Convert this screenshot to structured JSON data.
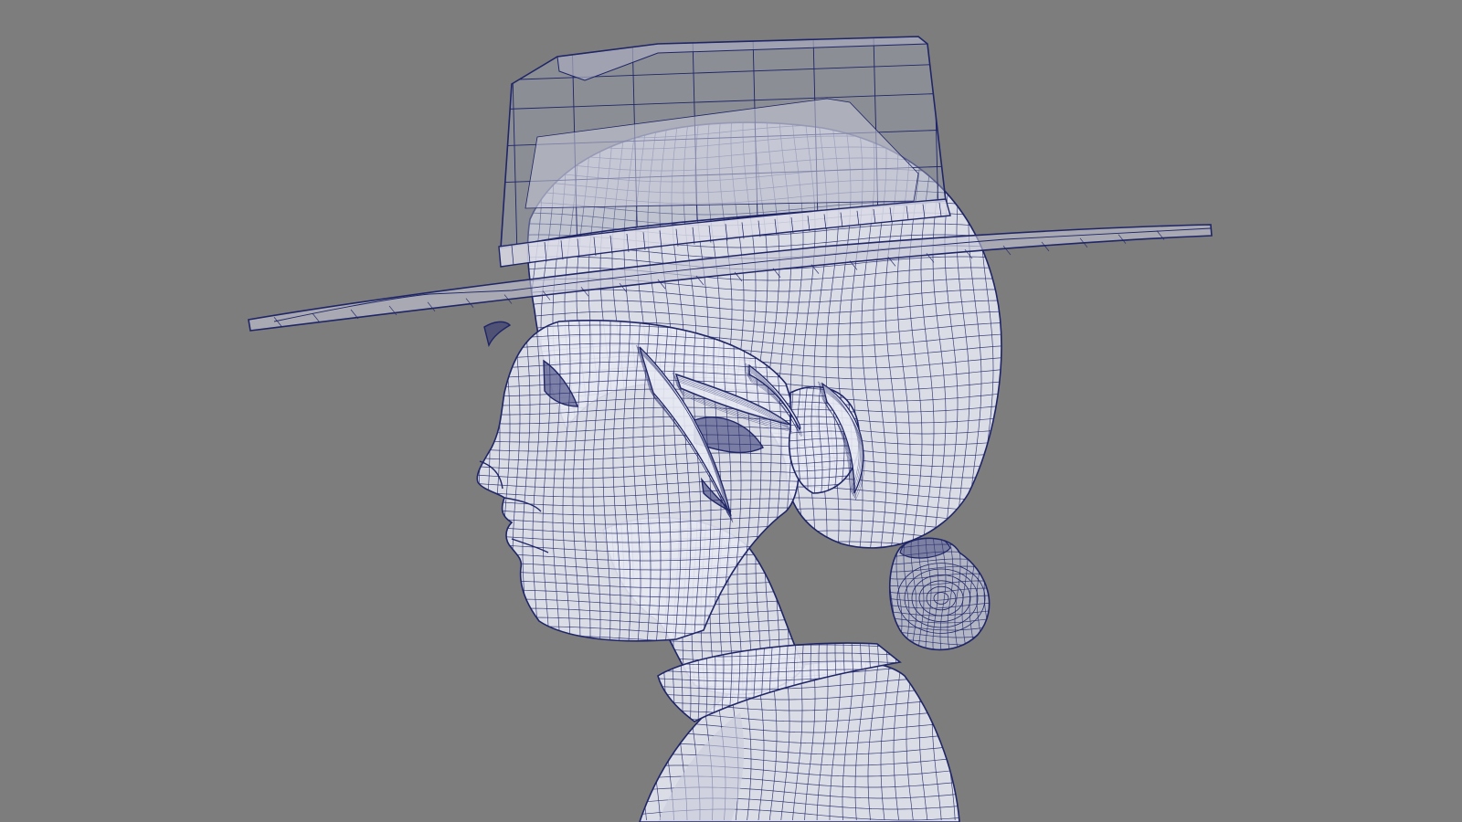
{
  "viewport": {
    "background_color": "#7d7d7d",
    "wire_color": "#1f2566",
    "mesh_fill_color": "#e6e8f2",
    "mesh_shade_color": "#c8cbdc",
    "display_mode": "wireframe-on-shaded"
  },
  "scene": {
    "model_view": "side-profile",
    "objects": [
      "hat",
      "hat-brim",
      "hat-band",
      "hair",
      "hair-bun",
      "face",
      "ear",
      "neck",
      "collar",
      "torso"
    ]
  }
}
